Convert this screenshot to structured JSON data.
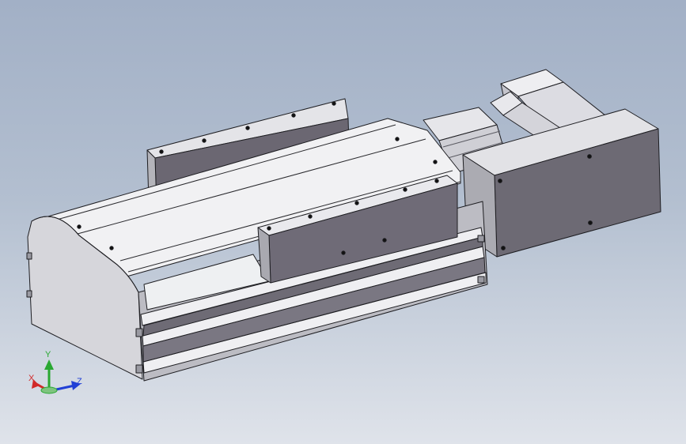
{
  "viewport": {
    "background_top": "#a2b0c6",
    "background_bottom": "#dfe3ea"
  },
  "model": {
    "part_type": "linear-actuator-module",
    "shade_light": "#f2f2f4",
    "shade_mid": "#c9c9cf",
    "shade_dark": "#6b6772",
    "edge_color": "#1e1e22"
  },
  "triad": {
    "x_label": "X",
    "y_label": "Y",
    "z_label": "Z",
    "x_color": "#d12a2a",
    "y_color": "#2aa832",
    "z_color": "#2140d6"
  }
}
